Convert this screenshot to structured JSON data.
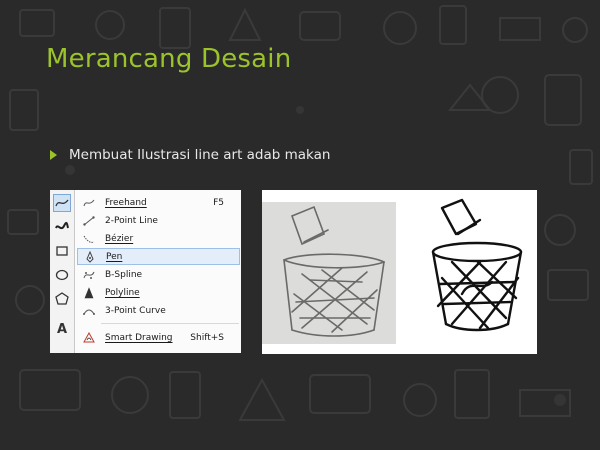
{
  "slide": {
    "title": "Merancang Desain",
    "bullet": "Membuat Ilustrasi line art adab makan"
  },
  "colors": {
    "background": "#2a2a2a",
    "accent": "#9bc32a",
    "text": "#e8e8e8"
  },
  "toolbox": {
    "tools": [
      {
        "name": "freehand-tool-icon"
      },
      {
        "name": "artistic-media-icon"
      },
      {
        "name": "rectangle-tool-icon"
      },
      {
        "name": "ellipse-tool-icon"
      },
      {
        "name": "polygon-tool-icon"
      },
      {
        "name": "text-tool-icon"
      }
    ]
  },
  "flyout_menu": {
    "items": [
      {
        "label": "Freehand",
        "shortcut": "F5",
        "icon": "freehand-icon"
      },
      {
        "label": "2-Point Line",
        "shortcut": "",
        "icon": "two-point-line-icon"
      },
      {
        "label": "Bézier",
        "shortcut": "",
        "icon": "bezier-icon"
      },
      {
        "label": "Pen",
        "shortcut": "",
        "icon": "pen-icon",
        "selected": true
      },
      {
        "label": "B-Spline",
        "shortcut": "",
        "icon": "b-spline-icon"
      },
      {
        "label": "Polyline",
        "shortcut": "",
        "icon": "polyline-icon"
      },
      {
        "label": "3-Point Curve",
        "shortcut": "",
        "icon": "three-point-curve-icon"
      },
      {
        "label": "Smart Drawing",
        "shortcut": "Shift+S",
        "icon": "smart-drawing-icon"
      }
    ]
  }
}
